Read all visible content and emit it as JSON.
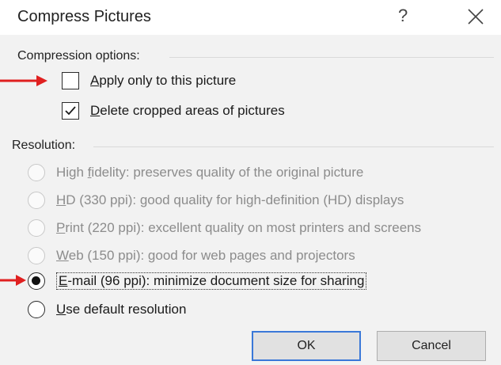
{
  "dialog": {
    "title": "Compress Pictures",
    "help_glyph": "?"
  },
  "compression": {
    "label": "Compression options:",
    "apply_only": {
      "pre": "",
      "u": "A",
      "post": "pply only to this picture",
      "checked": false
    },
    "delete_cropped": {
      "pre": "",
      "u": "D",
      "post": "elete cropped areas of pictures",
      "checked": true
    }
  },
  "resolution": {
    "label": "Resolution:",
    "options": [
      {
        "pre": "High ",
        "u": "f",
        "post": "idelity: preserves quality of the original picture",
        "enabled": false,
        "selected": false
      },
      {
        "pre": "",
        "u": "H",
        "post": "D (330 ppi): good quality for high-definition (HD) displays",
        "enabled": false,
        "selected": false
      },
      {
        "pre": "",
        "u": "P",
        "post": "rint (220 ppi): excellent quality on most printers and screens",
        "enabled": false,
        "selected": false
      },
      {
        "pre": "",
        "u": "W",
        "post": "eb (150 ppi): good for web pages and projectors",
        "enabled": false,
        "selected": false
      },
      {
        "pre": "",
        "u": "E",
        "post": "-mail (96 ppi): minimize document size for sharing",
        "enabled": true,
        "selected": true
      },
      {
        "pre": "",
        "u": "U",
        "post": "se default resolution",
        "enabled": true,
        "selected": false
      }
    ]
  },
  "buttons": {
    "ok": "OK",
    "cancel": "Cancel"
  },
  "colors": {
    "arrow": "#e02020",
    "ok_border": "#3a78d8"
  },
  "icons": {
    "close": "close-icon",
    "check": "checkmark-icon",
    "arrow": "red-arrow-icon"
  }
}
